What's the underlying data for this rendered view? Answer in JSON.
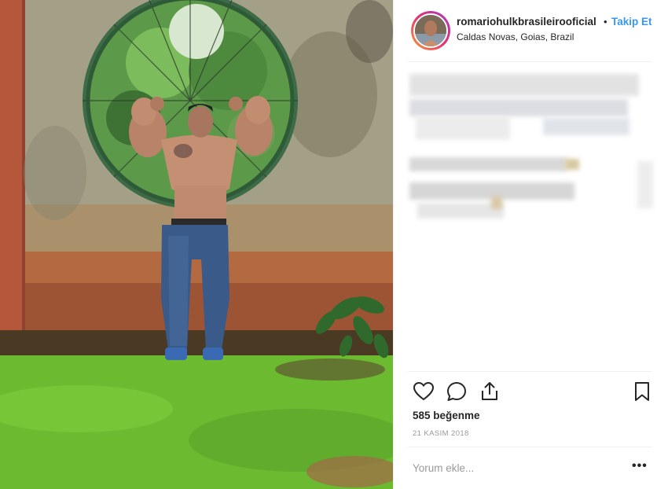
{
  "post": {
    "username": "romariohulkbrasileirooficial",
    "separator": "•",
    "follow_label": "Takip Et",
    "location": "Caldas Novas, Goias, Brazil",
    "likes": "585 beğenme",
    "date": "21 KASIM 2018",
    "comment_placeholder": "Yorum ekle...",
    "more_label": "•••"
  },
  "actions": {
    "icons": [
      "heart-icon",
      "comment-icon",
      "share-icon",
      "bookmark-icon"
    ]
  },
  "colors": {
    "link": "#3897f0",
    "text": "#262626",
    "muted": "#999999",
    "divider": "#efefef"
  }
}
